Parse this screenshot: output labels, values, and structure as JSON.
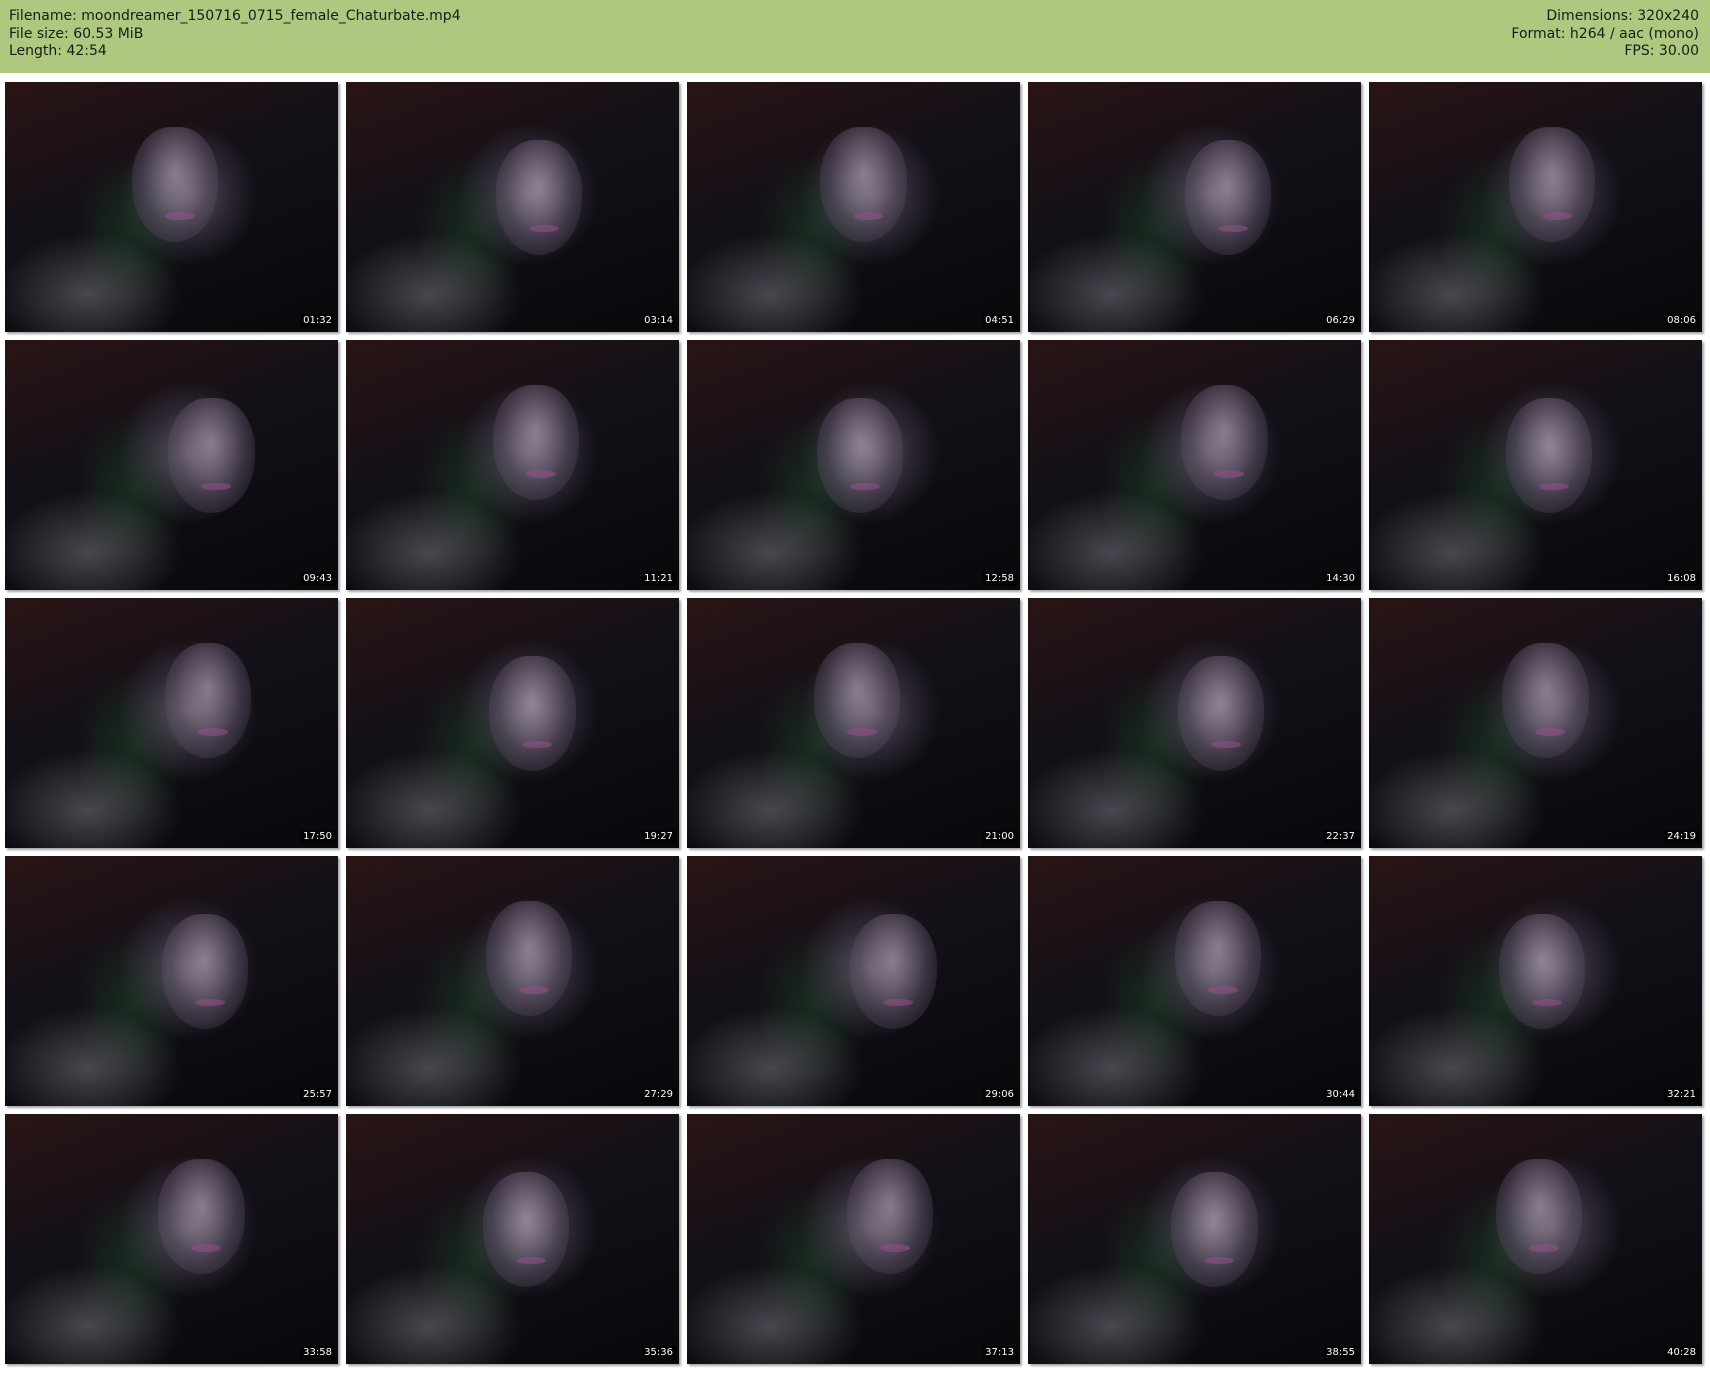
{
  "header": {
    "filename_label": "Filename: moondreamer_150716_0715_female_Chaturbate.mp4",
    "filesize_label": "File size: 60.53 MiB",
    "length_label": "Length: 42:54",
    "dimensions_label": "Dimensions: 320x240",
    "format_label": "Format: h264 / aac (mono)",
    "fps_label": "FPS: 30.00",
    "background_color": "#aec97f"
  },
  "thumbnails": [
    {
      "time": "01:32"
    },
    {
      "time": "03:14"
    },
    {
      "time": "04:51"
    },
    {
      "time": "06:29"
    },
    {
      "time": "08:06"
    },
    {
      "time": "09:43"
    },
    {
      "time": "11:21"
    },
    {
      "time": "12:58"
    },
    {
      "time": "14:30"
    },
    {
      "time": "16:08"
    },
    {
      "time": "17:50"
    },
    {
      "time": "19:27"
    },
    {
      "time": "21:00"
    },
    {
      "time": "22:37"
    },
    {
      "time": "24:19"
    },
    {
      "time": "25:57"
    },
    {
      "time": "27:29"
    },
    {
      "time": "29:06"
    },
    {
      "time": "30:44"
    },
    {
      "time": "32:21"
    },
    {
      "time": "33:58"
    },
    {
      "time": "35:36"
    },
    {
      "time": "37:13"
    },
    {
      "time": "38:55"
    },
    {
      "time": "40:28"
    }
  ]
}
